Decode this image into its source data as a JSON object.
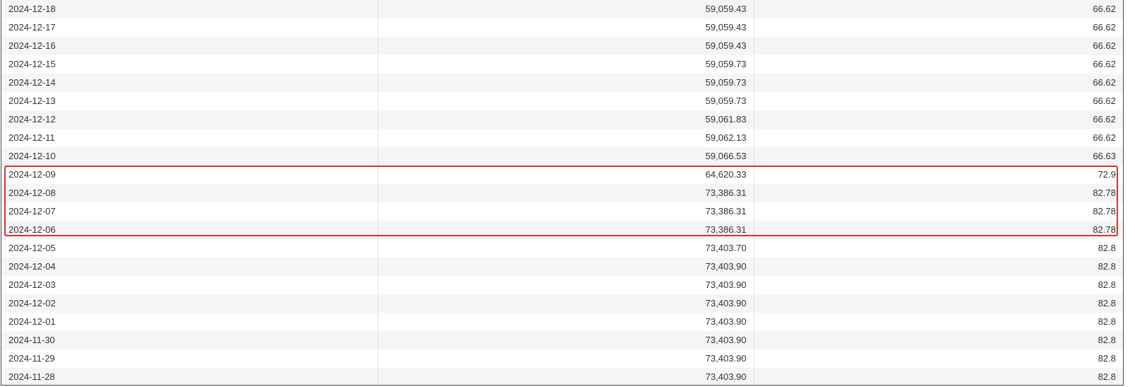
{
  "table": {
    "rows": [
      {
        "date": "2024-12-18",
        "value": "59,059.43",
        "rate": "66.62"
      },
      {
        "date": "2024-12-17",
        "value": "59,059.43",
        "rate": "66.62"
      },
      {
        "date": "2024-12-16",
        "value": "59,059.43",
        "rate": "66.62"
      },
      {
        "date": "2024-12-15",
        "value": "59,059.73",
        "rate": "66.62"
      },
      {
        "date": "2024-12-14",
        "value": "59,059.73",
        "rate": "66.62"
      },
      {
        "date": "2024-12-13",
        "value": "59,059.73",
        "rate": "66.62"
      },
      {
        "date": "2024-12-12",
        "value": "59,061.83",
        "rate": "66.62"
      },
      {
        "date": "2024-12-11",
        "value": "59,062.13",
        "rate": "66.62"
      },
      {
        "date": "2024-12-10",
        "value": "59,066.53",
        "rate": "66.63"
      },
      {
        "date": "2024-12-09",
        "value": "64,620.33",
        "rate": "72.9"
      },
      {
        "date": "2024-12-08",
        "value": "73,386.31",
        "rate": "82.78"
      },
      {
        "date": "2024-12-07",
        "value": "73,386.31",
        "rate": "82.78"
      },
      {
        "date": "2024-12-06",
        "value": "73,386.31",
        "rate": "82.78"
      },
      {
        "date": "2024-12-05",
        "value": "73,403.70",
        "rate": "82.8"
      },
      {
        "date": "2024-12-04",
        "value": "73,403.90",
        "rate": "82.8"
      },
      {
        "date": "2024-12-03",
        "value": "73,403.90",
        "rate": "82.8"
      },
      {
        "date": "2024-12-02",
        "value": "73,403.90",
        "rate": "82.8"
      },
      {
        "date": "2024-12-01",
        "value": "73,403.90",
        "rate": "82.8"
      },
      {
        "date": "2024-11-30",
        "value": "73,403.90",
        "rate": "82.8"
      },
      {
        "date": "2024-11-29",
        "value": "73,403.90",
        "rate": "82.8"
      },
      {
        "date": "2024-11-28",
        "value": "73,403.90",
        "rate": "82.8"
      }
    ]
  },
  "annotation": {
    "highlight_color": "#e0302b"
  },
  "colors": {
    "row_odd": "#f5f5f5",
    "row_even": "#ffffff",
    "text": "#333333"
  }
}
